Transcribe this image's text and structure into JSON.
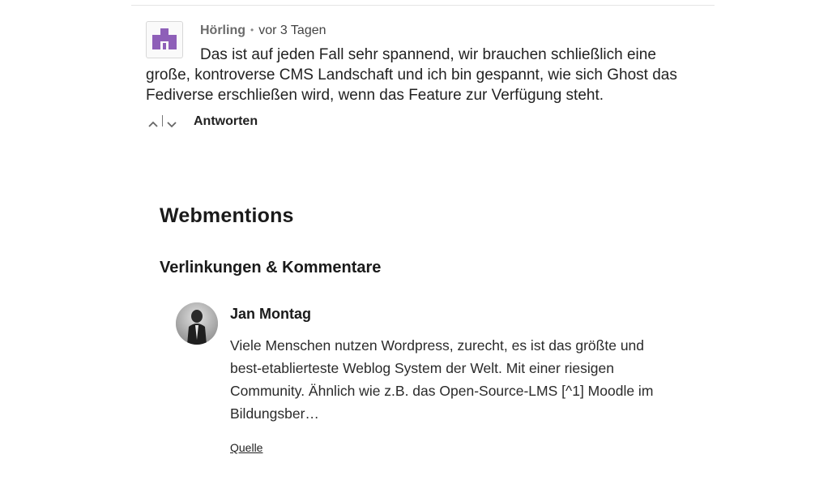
{
  "comment": {
    "author": "Hörling",
    "separator": "•",
    "time": "vor 3 Tagen",
    "text": "Das ist auf jeden Fall sehr spannend, wir brauchen schließlich eine große, kontroverse CMS Landschaft und ich bin gespannt, wie sich Ghost das Fediverse erschließen wird, wenn das Feature zur Verfügung steht.",
    "reply_label": "Antworten",
    "avatar_color": "#8e5fb8"
  },
  "webmentions": {
    "title": "Webmentions",
    "subtitle": "Verlinkungen & Kommentare",
    "items": [
      {
        "author": "Jan Montag",
        "text": "Viele Menschen nutzen Wordpress, zurecht, es ist das größte und best-etablierteste Weblog System der Welt. Mit einer riesigen Community. Ähnlich wie z.B. das Open-Source-LMS [^1] Moodle im Bildungsber…",
        "source_label": "Quelle"
      }
    ]
  }
}
